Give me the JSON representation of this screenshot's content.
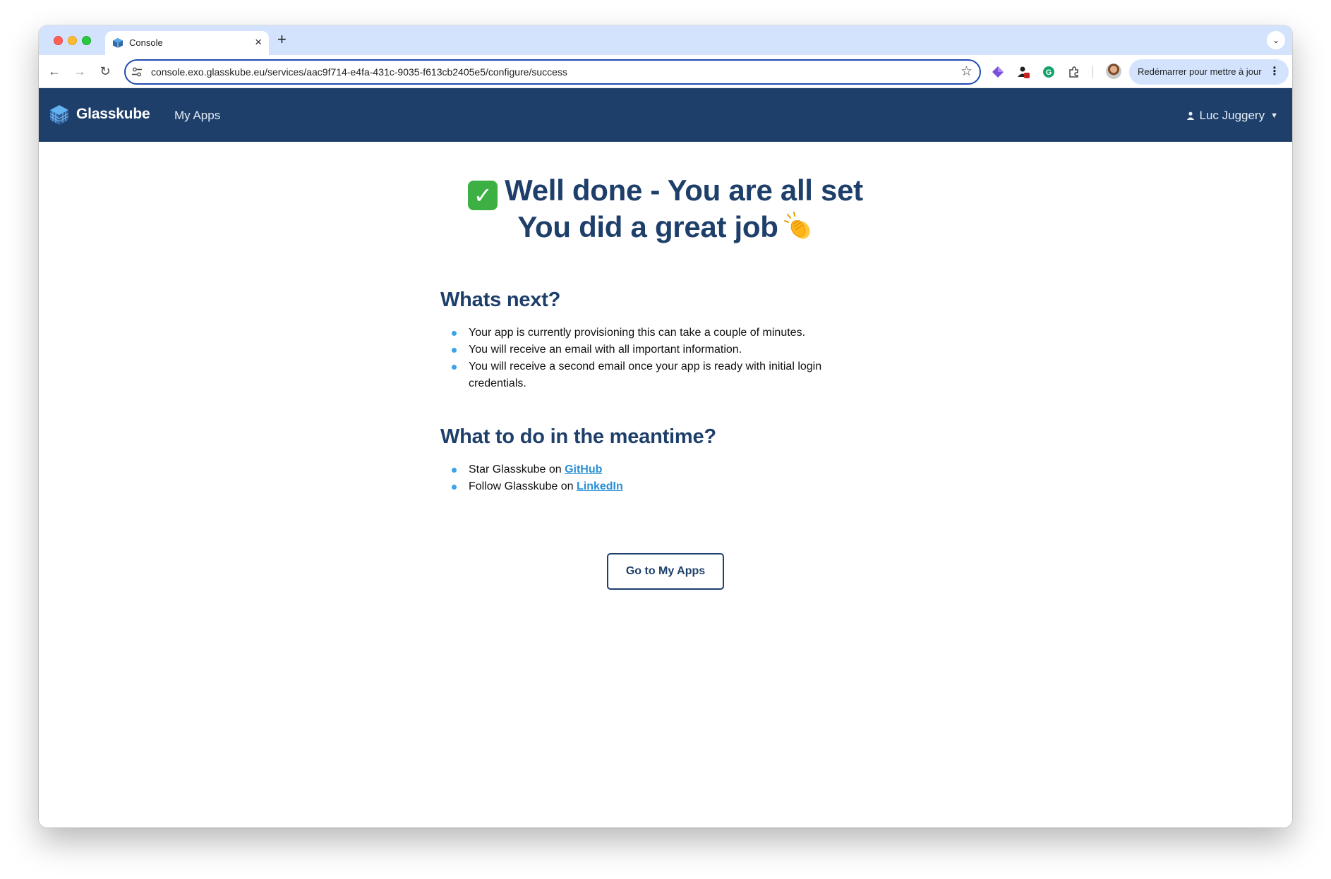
{
  "browser": {
    "tab_title": "Console",
    "url": "console.exo.glasskube.eu/services/aac9f714-e4fa-431c-9035-f613cb2405e5/configure/success",
    "update_button_label": "Redémarrer pour mettre à jour",
    "icons": {
      "back": "back-arrow-icon",
      "forward": "forward-arrow-icon",
      "reload": "reload-icon",
      "site_settings": "tune-icon",
      "bookmark": "star-icon",
      "menu": "kebab-menu-icon"
    }
  },
  "header": {
    "brand": "Glasskube",
    "nav_myapps": "My Apps",
    "user_name": "Luc Juggery",
    "background": "#1e3f6a"
  },
  "main": {
    "hero_line1": "Well done - You are all set",
    "hero_line2": "You did a great job",
    "check_glyph": "✓",
    "next_heading": "Whats next?",
    "next_items": [
      "Your app is currently provisioning this can take a couple of minutes.",
      "You will receive an email with all important information.",
      "You will receive a second email once your app is ready with initial login credentials."
    ],
    "meantime_heading": "What to do in the meantime?",
    "meantime_items": [
      {
        "prefix": "Star Glasskube on ",
        "link": "GitHub"
      },
      {
        "prefix": "Follow Glasskube on ",
        "link": "LinkedIn"
      }
    ],
    "cta_label": "Go to My Apps"
  },
  "colors": {
    "brand_navy": "#1e3f6a",
    "link_blue": "#2a8fd6",
    "bullet_blue": "#3ba3e6",
    "check_green": "#3cb043"
  }
}
